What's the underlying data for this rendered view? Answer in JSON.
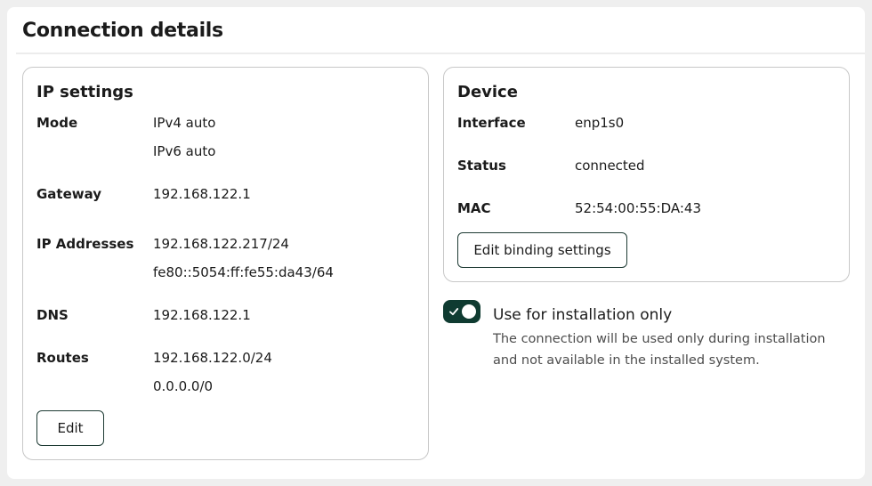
{
  "page": {
    "title": "Connection details"
  },
  "ip_settings": {
    "title": "IP settings",
    "mode_label": "Mode",
    "mode_values": [
      "IPv4 auto",
      "IPv6 auto"
    ],
    "gateway_label": "Gateway",
    "gateway_value": "192.168.122.1",
    "ip_addresses_label": "IP Addresses",
    "ip_addresses_values": [
      "192.168.122.217/24",
      "fe80::5054:ff:fe55:da43/64"
    ],
    "dns_label": "DNS",
    "dns_value": "192.168.122.1",
    "routes_label": "Routes",
    "routes_values": [
      "192.168.122.0/24",
      "0.0.0.0/0"
    ],
    "edit_button": "Edit"
  },
  "device": {
    "title": "Device",
    "interface_label": "Interface",
    "interface_value": "enp1s0",
    "status_label": "Status",
    "status_value": "connected",
    "mac_label": "MAC",
    "mac_value": "52:54:00:55:DA:43",
    "binding_button": "Edit binding settings"
  },
  "installation_only": {
    "checked": true,
    "label": "Use for installation only",
    "help": "The connection will be used only during installation and not available in the installed system."
  },
  "colors": {
    "accent": "#0f3b31",
    "border": "#c8c8c8",
    "background": "#efefef"
  }
}
